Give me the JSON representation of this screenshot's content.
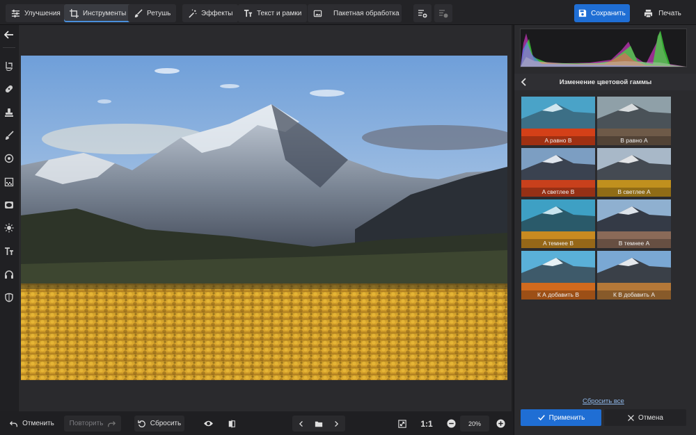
{
  "toolbar": {
    "tabs": [
      {
        "label": "Улучшения",
        "icon": "sliders-icon"
      },
      {
        "label": "Инструменты",
        "icon": "crop-icon"
      },
      {
        "label": "Ретушь",
        "icon": "brush-icon"
      },
      {
        "label": "Эффекты",
        "icon": "magic-wand-icon"
      },
      {
        "label": "Текст и рамки",
        "icon": "text-icon"
      },
      {
        "label": "Пакетная обработка",
        "icon": "image-stack-icon"
      }
    ],
    "active_tab": "Инструменты",
    "save_label": "Сохранить",
    "print_label": "Печать"
  },
  "panel": {
    "title": "Изменение цветовой гаммы",
    "presets": [
      {
        "label": "A равно B"
      },
      {
        "label": "B равно A"
      },
      {
        "label": "A светлее B"
      },
      {
        "label": "B светлее A"
      },
      {
        "label": "A темнее B"
      },
      {
        "label": "B темнее A"
      },
      {
        "label": "К А добавить B"
      },
      {
        "label": "К B добавить A"
      }
    ],
    "reset_all_label": "Сбросить все",
    "apply_label": "Применить",
    "cancel_label": "Отмена"
  },
  "bottom": {
    "undo_label": "Отменить",
    "redo_label": "Повторить",
    "reset_label": "Сбросить",
    "ratio_label": "1:1",
    "zoom_value": "20%"
  },
  "colors": {
    "accent": "#1f6ed4",
    "link": "#8fb8ea"
  }
}
